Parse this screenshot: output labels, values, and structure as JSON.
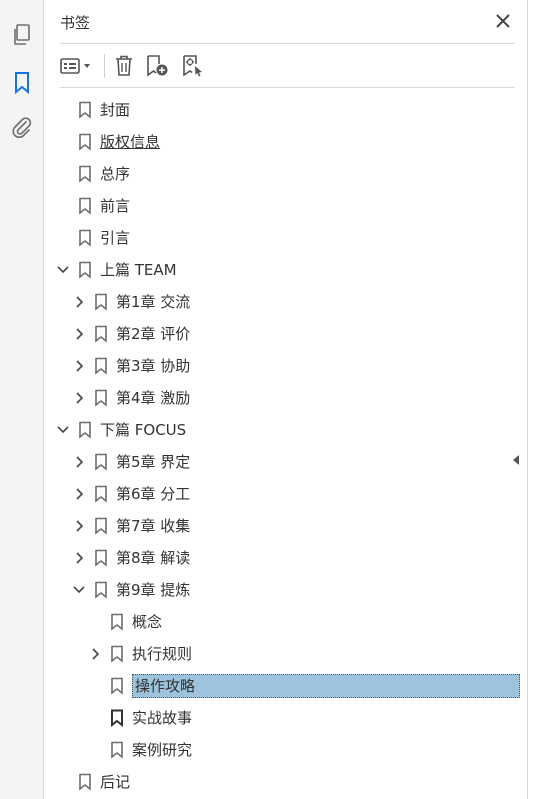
{
  "panel": {
    "title": "书签"
  },
  "tree": [
    {
      "label": "封面",
      "level": 0,
      "chevron": "none"
    },
    {
      "label": "版权信息",
      "level": 0,
      "chevron": "none",
      "underline": true
    },
    {
      "label": "总序",
      "level": 0,
      "chevron": "none"
    },
    {
      "label": "前言",
      "level": 0,
      "chevron": "none"
    },
    {
      "label": "引言",
      "level": 0,
      "chevron": "none"
    },
    {
      "label": "上篇 TEAM",
      "level": 0,
      "chevron": "down"
    },
    {
      "label": "第1章 交流",
      "level": 1,
      "chevron": "right"
    },
    {
      "label": "第2章 评价",
      "level": 1,
      "chevron": "right"
    },
    {
      "label": "第3章 协助",
      "level": 1,
      "chevron": "right"
    },
    {
      "label": "第4章 激励",
      "level": 1,
      "chevron": "right"
    },
    {
      "label": "下篇 FOCUS",
      "level": 0,
      "chevron": "down"
    },
    {
      "label": "第5章 界定",
      "level": 1,
      "chevron": "right"
    },
    {
      "label": "第6章 分工",
      "level": 1,
      "chevron": "right"
    },
    {
      "label": "第7章 收集",
      "level": 1,
      "chevron": "right"
    },
    {
      "label": "第8章 解读",
      "level": 1,
      "chevron": "right"
    },
    {
      "label": "第9章 提炼",
      "level": 1,
      "chevron": "down"
    },
    {
      "label": "概念",
      "level": 2,
      "chevron": "none"
    },
    {
      "label": "执行规则",
      "level": 2,
      "chevron": "right"
    },
    {
      "label": "操作攻略",
      "level": 2,
      "chevron": "none",
      "selected": true
    },
    {
      "label": "实战故事",
      "level": 2,
      "chevron": "none",
      "dark_icon": true
    },
    {
      "label": "案例研究",
      "level": 2,
      "chevron": "none"
    },
    {
      "label": "后记",
      "level": 0,
      "chevron": "none"
    }
  ],
  "icons": {
    "rail": [
      "pages-icon",
      "bookmark-icon",
      "attachment-icon"
    ],
    "toolbar": [
      "options-menu-icon",
      "delete-bookmark-icon",
      "new-bookmark-icon",
      "bookmark-from-structure-icon"
    ],
    "close": "close-icon",
    "edge": "collapse-panel-icon"
  },
  "colors": {
    "accent": "#1473e6",
    "selection": "#9dc3dd",
    "icon": "#6e6e6e"
  }
}
